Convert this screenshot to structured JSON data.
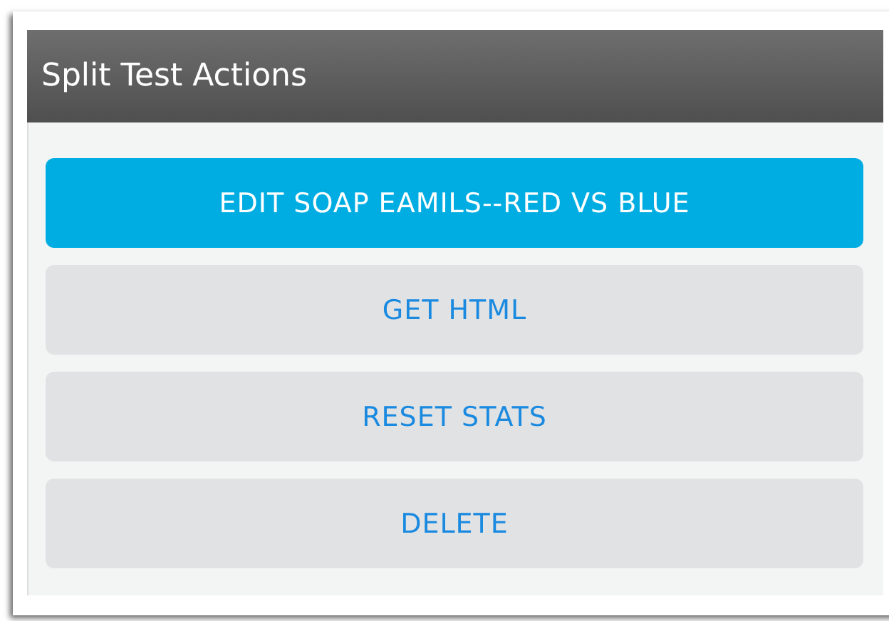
{
  "panel": {
    "title": "Split Test Actions"
  },
  "actions": [
    {
      "label": "EDIT SOAP EAMILS--RED VS BLUE",
      "selected": true
    },
    {
      "label": "GET HTML",
      "selected": false
    },
    {
      "label": "RESET STATS",
      "selected": false
    },
    {
      "label": "DELETE",
      "selected": false
    }
  ]
}
